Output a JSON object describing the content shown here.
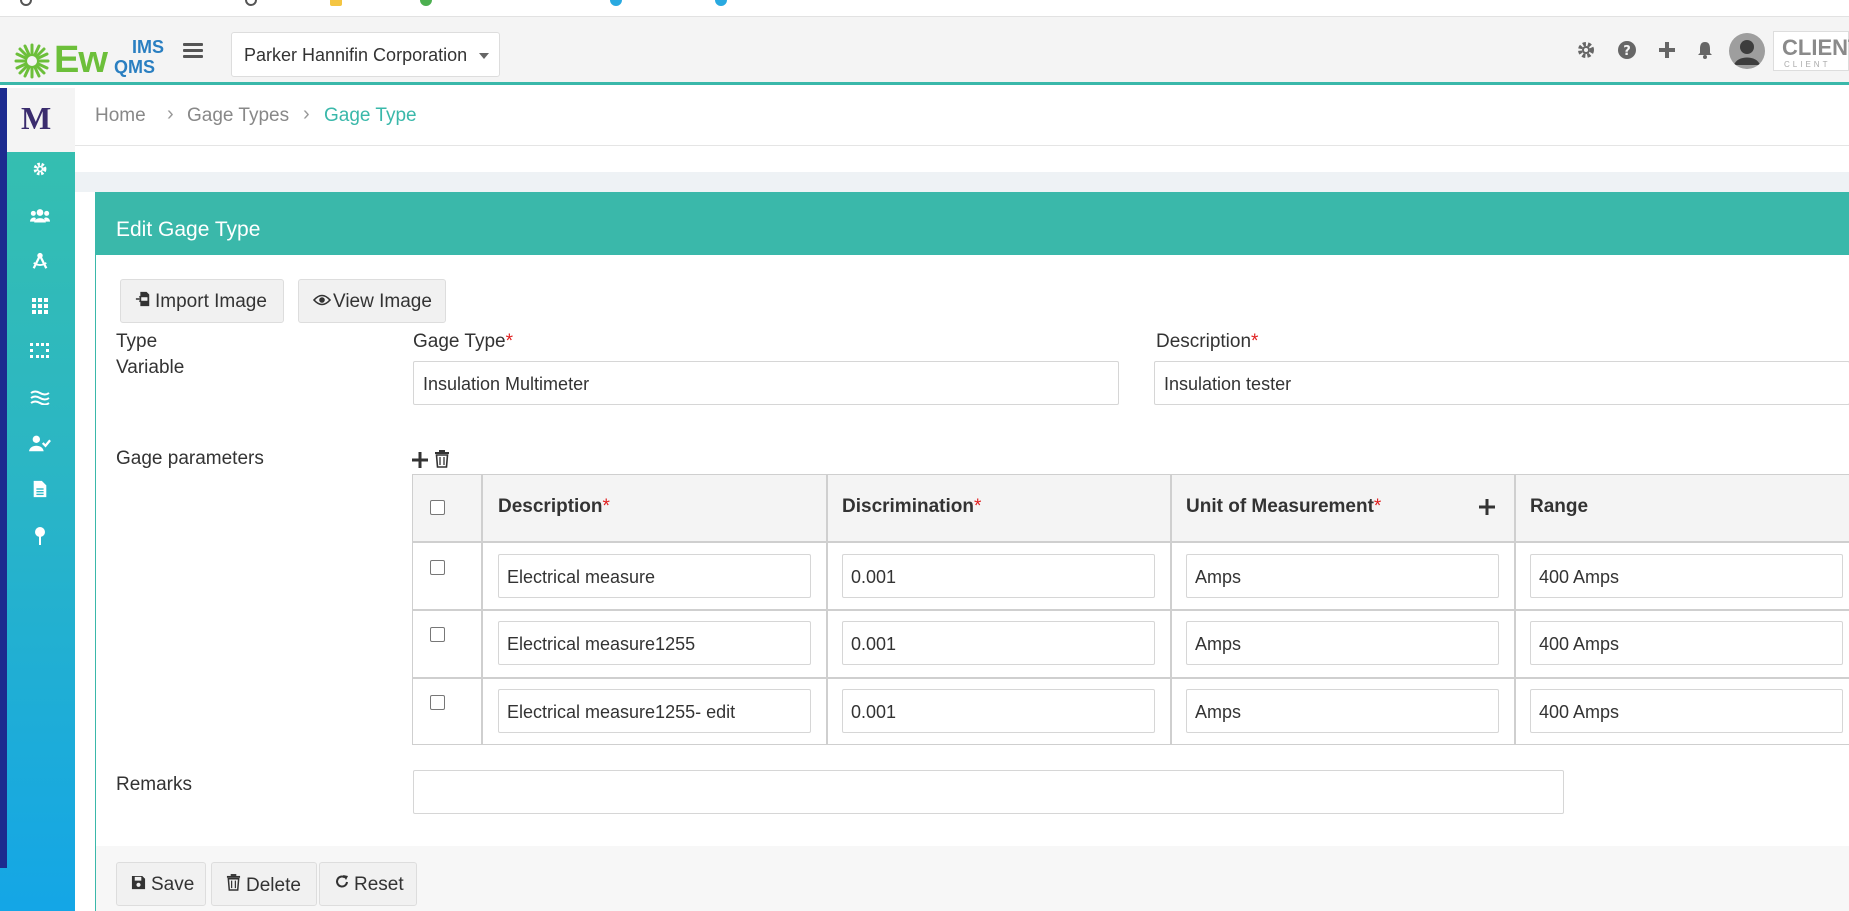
{
  "header": {
    "logo": {
      "ew": "Ew",
      "ims": "IMS",
      "qms": "QMS"
    },
    "company": "Parker Hannifin Corporation",
    "client_logo_main": "CLIENT",
    "client_logo_sub": "CLIENT",
    "icons": [
      "gear-icon",
      "question-icon",
      "plus-icon",
      "bell-icon",
      "user-avatar"
    ]
  },
  "sidebar": {
    "logo": "M",
    "items": [
      "gear-icon",
      "users-icon",
      "compass-icon",
      "grid-icon",
      "dots-grid-icon",
      "waves-icon",
      "user-check-icon",
      "document-icon",
      "pin-icon"
    ]
  },
  "breadcrumb": {
    "items": [
      "Home",
      "Gage Types",
      "Gage Type"
    ]
  },
  "card": {
    "title": "Edit Gage Type",
    "import_image": "Import Image",
    "view_image": "View Image",
    "type_label": "Type",
    "type_value": "Variable",
    "gage_type_label": "Gage Type",
    "gage_type_value": "Insulation Multimeter",
    "description_label": "Description",
    "description_value": "Insulation tester",
    "gage_parameters_label": "Gage parameters",
    "remarks_label": "Remarks",
    "remarks_value": "",
    "required_mark": "*"
  },
  "table": {
    "headers": {
      "description": "Description",
      "discrimination": "Discrimination",
      "unit": "Unit of Measurement",
      "range": "Range"
    },
    "rows": [
      {
        "description": "Electrical measure",
        "discrimination": "0.001",
        "unit": "Amps",
        "range": "400 Amps"
      },
      {
        "description": "Electrical measure1255",
        "discrimination": "0.001",
        "unit": "Amps",
        "range": "400 Amps"
      },
      {
        "description": "Electrical measure1255- edit",
        "discrimination": "0.001",
        "unit": "Amps",
        "range": "400 Amps"
      }
    ]
  },
  "footer": {
    "save": "Save",
    "delete": "Delete",
    "reset": "Reset"
  },
  "colors": {
    "accent": "#3ab8aa",
    "required": "#e02020"
  }
}
